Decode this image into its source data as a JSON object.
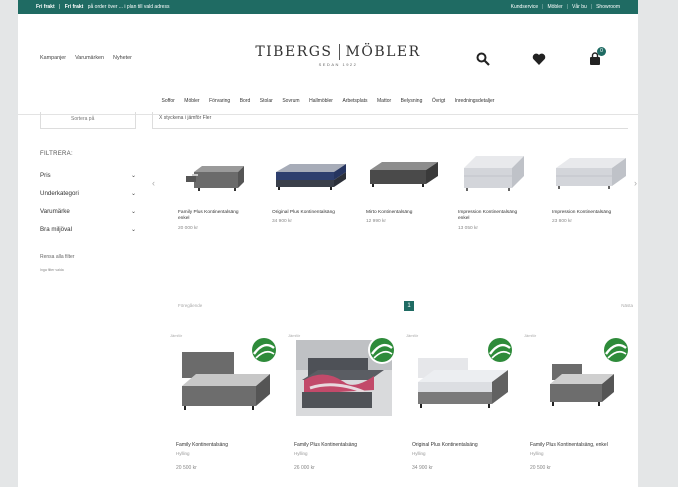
{
  "topbar": {
    "promo_bold": "Fri frakt",
    "promo_bold2": "Fri frakt",
    "promo_text": "på order över ... i plan till vald adress",
    "links": [
      "Kundservice",
      "Möbler",
      "Vår bu",
      "Showroom"
    ]
  },
  "header": {
    "left_nav": [
      "Kampanjer",
      "Varumärken",
      "Nyheter"
    ],
    "logo_left": "TIBERGS",
    "logo_right": "MÖBLER",
    "logo_since": "SEDAN 1922",
    "cart_count": "0"
  },
  "category_nav": [
    "Soffor",
    "Möbler",
    "Förvaring",
    "Bord",
    "Stolar",
    "Sovrum",
    "Hallmöbler",
    "Arbetsplats",
    "Mattor",
    "Belysning",
    "Övrigt",
    "Inredningsdetaljer"
  ],
  "sort": {
    "label": "Sortera på",
    "results": "X styckena i jämför Fler"
  },
  "filters": {
    "title": "FILTRERA:",
    "items": [
      "Pris",
      "Underkategori",
      "Varumärke",
      "Bra miljöval"
    ],
    "reset": "Rensa alla filter",
    "selected": "Inga filter valda"
  },
  "carousel": [
    {
      "title": "Family Plus Kontinentalsäng enkel",
      "price": "20 000 kr"
    },
    {
      "title": "Original Plus Kontinentalsäng",
      "price": "34 900 kr"
    },
    {
      "title": "Mirto Kontinentalsäng",
      "price": "12 990 kr"
    },
    {
      "title": "Impression Kontinentalsäng enkel",
      "price": "13 050 kr"
    },
    {
      "title": "Impression Kontinentalsäng",
      "price": "23 800 kr"
    }
  ],
  "pager": {
    "prev": "Föregående",
    "page": "1",
    "next": "Nästa"
  },
  "products": [
    {
      "title": "Family Kontinentalsäng",
      "sub": "Hylling",
      "price": "20 500 kr",
      "compare": "Jämför"
    },
    {
      "title": "Family Plus Kontinentalsäng",
      "sub": "Hylling",
      "price": "26 000 kr",
      "compare": "Jämför"
    },
    {
      "title": "Original Plus Kontinentalsäng",
      "sub": "Hylling",
      "price": "34 900 kr",
      "compare": "Jämför"
    },
    {
      "title": "Family Plus Kontinentalsäng, enkel",
      "sub": "Hylling",
      "price": "20 500 kr",
      "compare": "Jämför"
    }
  ],
  "colors": {
    "accent": "#1f6b63",
    "eco": "#2e8b3a"
  }
}
